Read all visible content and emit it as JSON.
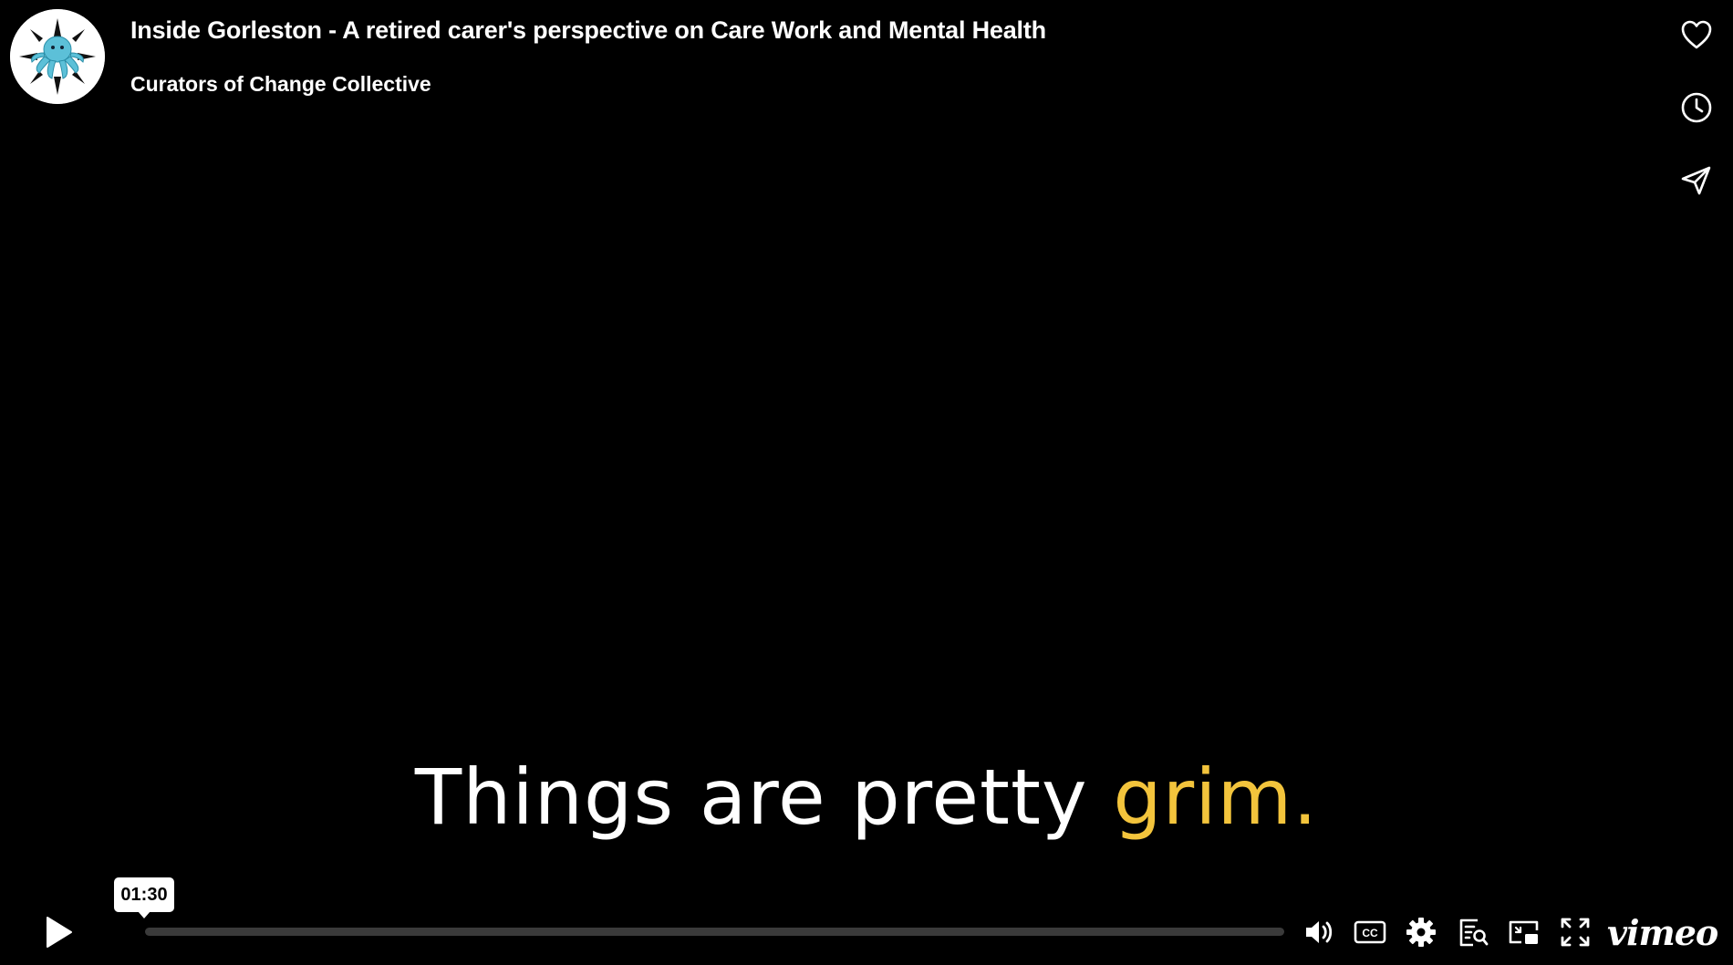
{
  "header": {
    "title": "Inside Gorleston - A retired carer's perspective on Care Work and Mental Health",
    "byline": "Curators of Change Collective"
  },
  "side_actions": [
    {
      "name": "like",
      "icon": "heart-icon"
    },
    {
      "name": "watch-later",
      "icon": "clock-icon"
    },
    {
      "name": "share",
      "icon": "send-icon"
    }
  ],
  "subtitle": {
    "text_main": "Things are pretty ",
    "text_highlight": "grim."
  },
  "controls": {
    "play_icon": "play-icon",
    "tooltip_time": "01:30",
    "progress": 0.0,
    "brand": "vimeo"
  },
  "colors": {
    "background": "#000000",
    "highlight": "#f3c43c",
    "text": "#ffffff"
  }
}
